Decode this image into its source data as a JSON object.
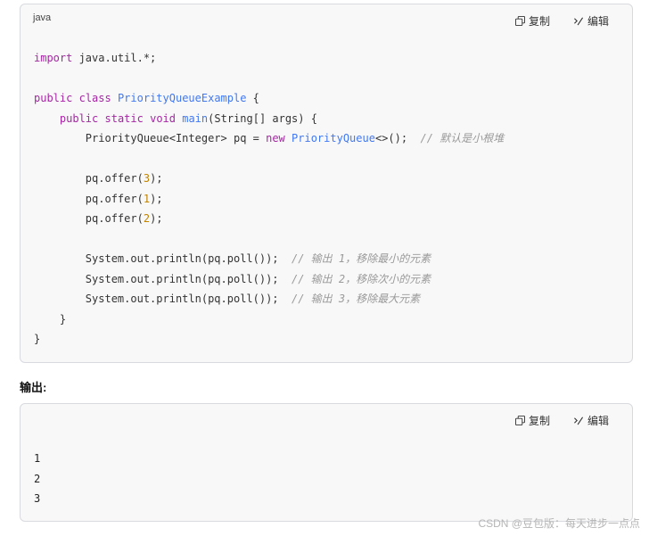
{
  "code_block": {
    "language": "java",
    "copy_label": "复制",
    "edit_label": "编辑",
    "lines": [
      [
        [
          "kw",
          "import"
        ],
        [
          "pl",
          " java.util.*;"
        ]
      ],
      [],
      [
        [
          "kw",
          "public"
        ],
        [
          "pl",
          " "
        ],
        [
          "kw",
          "class"
        ],
        [
          "pl",
          " "
        ],
        [
          "ty",
          "PriorityQueueExample"
        ],
        [
          "pl",
          " {"
        ]
      ],
      [
        [
          "pl",
          "    "
        ],
        [
          "kw",
          "public"
        ],
        [
          "pl",
          " "
        ],
        [
          "kw",
          "static"
        ],
        [
          "pl",
          " "
        ],
        [
          "kw",
          "void"
        ],
        [
          "pl",
          " "
        ],
        [
          "ty",
          "main"
        ],
        [
          "pl",
          "(String[] args) {"
        ]
      ],
      [
        [
          "pl",
          "        PriorityQueue<Integer> pq = "
        ],
        [
          "kw",
          "new"
        ],
        [
          "pl",
          " "
        ],
        [
          "ty",
          "PriorityQueue"
        ],
        [
          "pl",
          "<>();  "
        ],
        [
          "cm",
          "// 默认是小根堆"
        ]
      ],
      [],
      [
        [
          "pl",
          "        pq.offer("
        ],
        [
          "nu",
          "3"
        ],
        [
          "pl",
          ");"
        ]
      ],
      [
        [
          "pl",
          "        pq.offer("
        ],
        [
          "nu",
          "1"
        ],
        [
          "pl",
          ");"
        ]
      ],
      [
        [
          "pl",
          "        pq.offer("
        ],
        [
          "nu",
          "2"
        ],
        [
          "pl",
          ");"
        ]
      ],
      [],
      [
        [
          "pl",
          "        System.out.println(pq.poll());  "
        ],
        [
          "cm",
          "// 输出 1，移除最小的元素"
        ]
      ],
      [
        [
          "pl",
          "        System.out.println(pq.poll());  "
        ],
        [
          "cm",
          "// 输出 2，移除次小的元素"
        ]
      ],
      [
        [
          "pl",
          "        System.out.println(pq.poll());  "
        ],
        [
          "cm",
          "// 输出 3，移除最大元素"
        ]
      ],
      [
        [
          "pl",
          "    }"
        ]
      ],
      [
        [
          "pl",
          "}"
        ]
      ]
    ]
  },
  "output_section": {
    "label": "输出:",
    "copy_label": "复制",
    "edit_label": "编辑",
    "lines": [
      "1",
      "2",
      "3"
    ]
  },
  "watermark": "CSDN @豆包版：每天进步一点点",
  "colors": {
    "keyword": "#a626a4",
    "type": "#4078f2",
    "number": "#c18401",
    "comment": "#9a9a9a",
    "block_background": "#f8f8f9"
  }
}
